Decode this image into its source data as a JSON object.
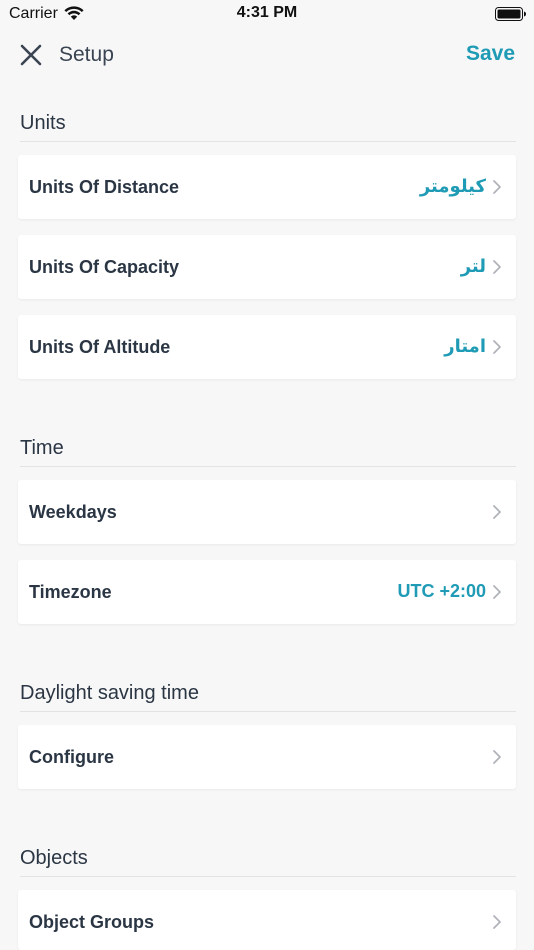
{
  "status_bar": {
    "carrier": "Carrier",
    "time": "4:31 PM"
  },
  "nav": {
    "title": "Setup",
    "save_label": "Save",
    "close_icon": "close-icon"
  },
  "colors": {
    "accent": "#1f9bb5",
    "background": "#f7f7f7",
    "card": "#ffffff",
    "text": "#2b3644"
  },
  "sections": {
    "units": {
      "header": "Units",
      "items": [
        {
          "label": "Units Of Distance",
          "value": "كيلومتر"
        },
        {
          "label": "Units Of Capacity",
          "value": "لتر"
        },
        {
          "label": "Units Of Altitude",
          "value": "امتار"
        }
      ]
    },
    "time": {
      "header": "Time",
      "items": [
        {
          "label": "Weekdays",
          "value": ""
        },
        {
          "label": "Timezone",
          "value": "UTC +2:00"
        }
      ]
    },
    "dst": {
      "header": "Daylight saving time",
      "items": [
        {
          "label": "Configure",
          "value": ""
        }
      ]
    },
    "objects": {
      "header": "Objects",
      "items": [
        {
          "label": "Object Groups",
          "value": ""
        }
      ]
    }
  }
}
